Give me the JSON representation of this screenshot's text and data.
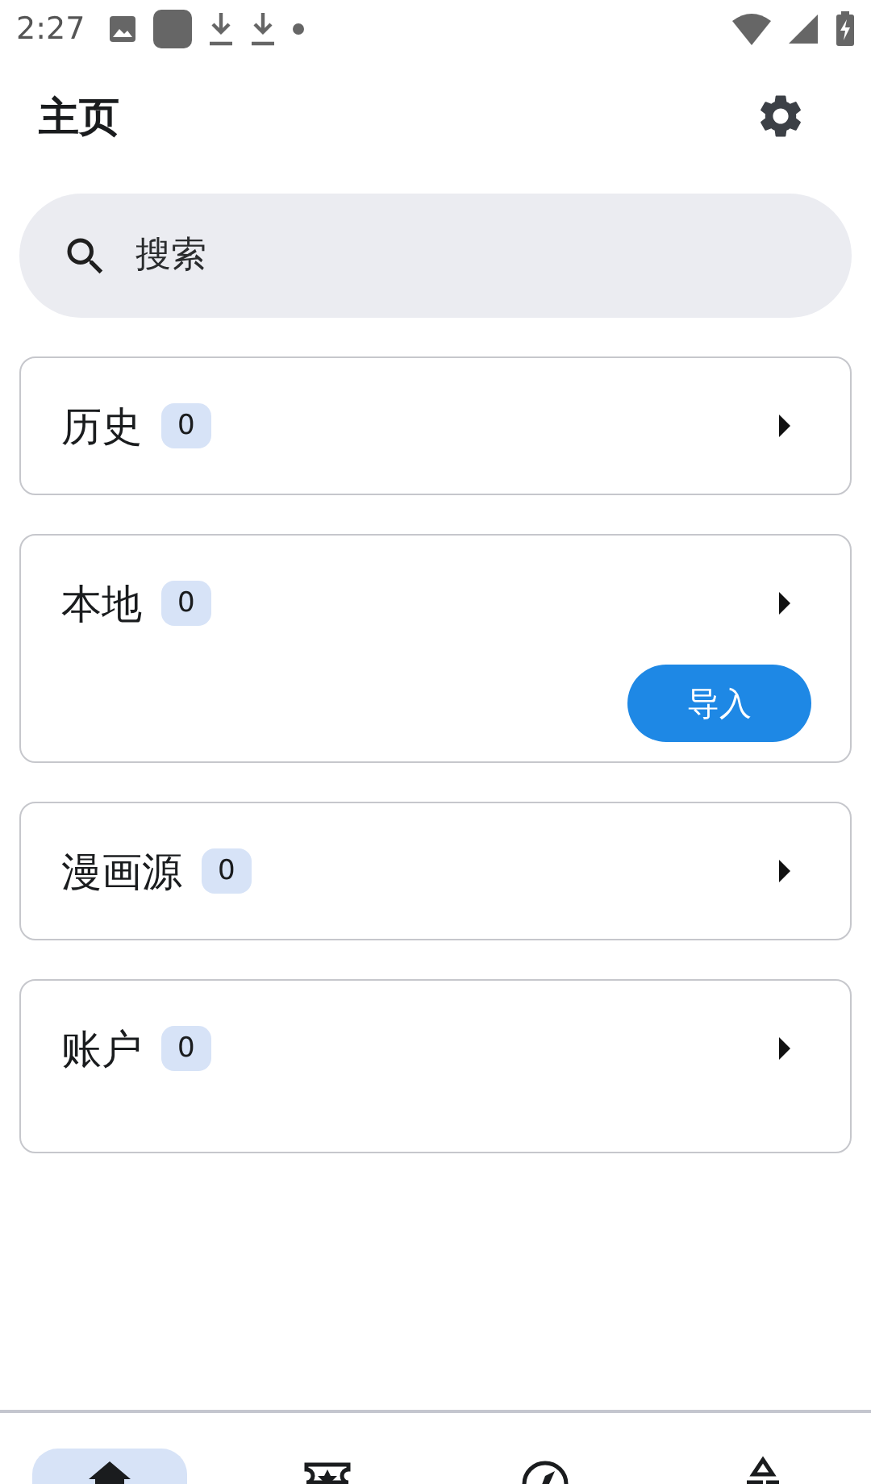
{
  "status_bar": {
    "time": "2:27"
  },
  "header": {
    "title": "主页"
  },
  "search": {
    "placeholder": "搜索"
  },
  "cards": [
    {
      "title": "历史",
      "count": "0"
    },
    {
      "title": "本地",
      "count": "0",
      "button": "导入"
    },
    {
      "title": "漫画源",
      "count": "0"
    },
    {
      "title": "账户",
      "count": "0"
    }
  ],
  "nav": [
    {
      "kind": "home",
      "selected": true
    },
    {
      "kind": "ticket",
      "selected": false
    },
    {
      "kind": "compass",
      "selected": false
    },
    {
      "kind": "shapes",
      "selected": false
    }
  ]
}
